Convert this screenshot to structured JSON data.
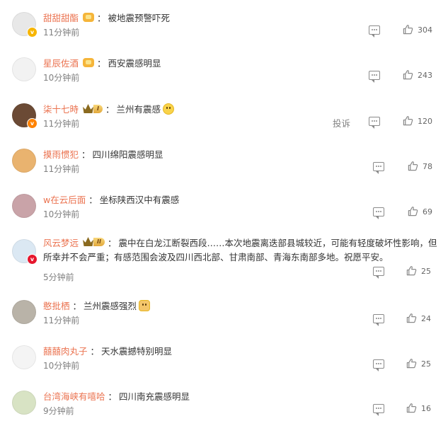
{
  "comments": [
    {
      "name": "甜甜甜酯",
      "badge": "crown",
      "text": "被地震预警吓死",
      "time": "11分钟前",
      "likes": "304",
      "report": "",
      "avatar_color": "#e8e8e8",
      "vbadge": "#f7b500",
      "emoji": ""
    },
    {
      "name": "星辰佐酒",
      "badge": "crown",
      "text": "西安震感明显",
      "time": "10分钟前",
      "likes": "243",
      "report": "",
      "avatar_color": "#f2f2f2",
      "vbadge": "",
      "emoji": ""
    },
    {
      "name": "柒十七時",
      "badge": "vip",
      "vip_level": "I",
      "text": "兰州有震感",
      "time": "11分钟前",
      "likes": "120",
      "report": "投诉",
      "avatar_color": "#6b4a35",
      "vbadge": "#ff8200",
      "emoji": "face"
    },
    {
      "name": "摸雨惯犯",
      "badge": "",
      "text": "四川绵阳震感明显",
      "time": "11分钟前",
      "likes": "78",
      "report": "",
      "avatar_color": "#e9b36f",
      "vbadge": "",
      "emoji": ""
    },
    {
      "name": "w在云后面",
      "badge": "",
      "text": "坐标陕西汉中有震感",
      "time": "10分钟前",
      "likes": "69",
      "report": "",
      "avatar_color": "#c9a3a8",
      "vbadge": "",
      "emoji": ""
    },
    {
      "name": "风云梦远",
      "badge": "vip",
      "vip_level": "II",
      "text": "震中在白龙江断裂西段……本次地震离迭部县城较近，可能有轻度破坏性影响，但所幸并不会严重；有感范围会波及四川西北部、甘肃南部、青海东南部多地。祝愿平安。",
      "time": "5分钟前",
      "likes": "25",
      "report": "",
      "avatar_color": "#dbe8f3",
      "vbadge": "#e6162d",
      "emoji": ""
    },
    {
      "name": "憨批栖",
      "badge": "",
      "text": "兰州震感强烈",
      "time": "11分钟前",
      "likes": "24",
      "report": "",
      "avatar_color": "#b9b3a8",
      "vbadge": "",
      "emoji": "cat"
    },
    {
      "name": "囍囍肉丸子",
      "badge": "",
      "text": "天水震撼特别明显",
      "time": "10分钟前",
      "likes": "25",
      "report": "",
      "avatar_color": "#f4f4f4",
      "vbadge": "",
      "emoji": ""
    },
    {
      "name": "台湾海峡有嘻哈",
      "badge": "",
      "text": "四川南充震感明显",
      "time": "9分钟前",
      "likes": "16",
      "report": "",
      "avatar_color": "#d8e3c4",
      "vbadge": "",
      "emoji": ""
    }
  ],
  "separator": "："
}
